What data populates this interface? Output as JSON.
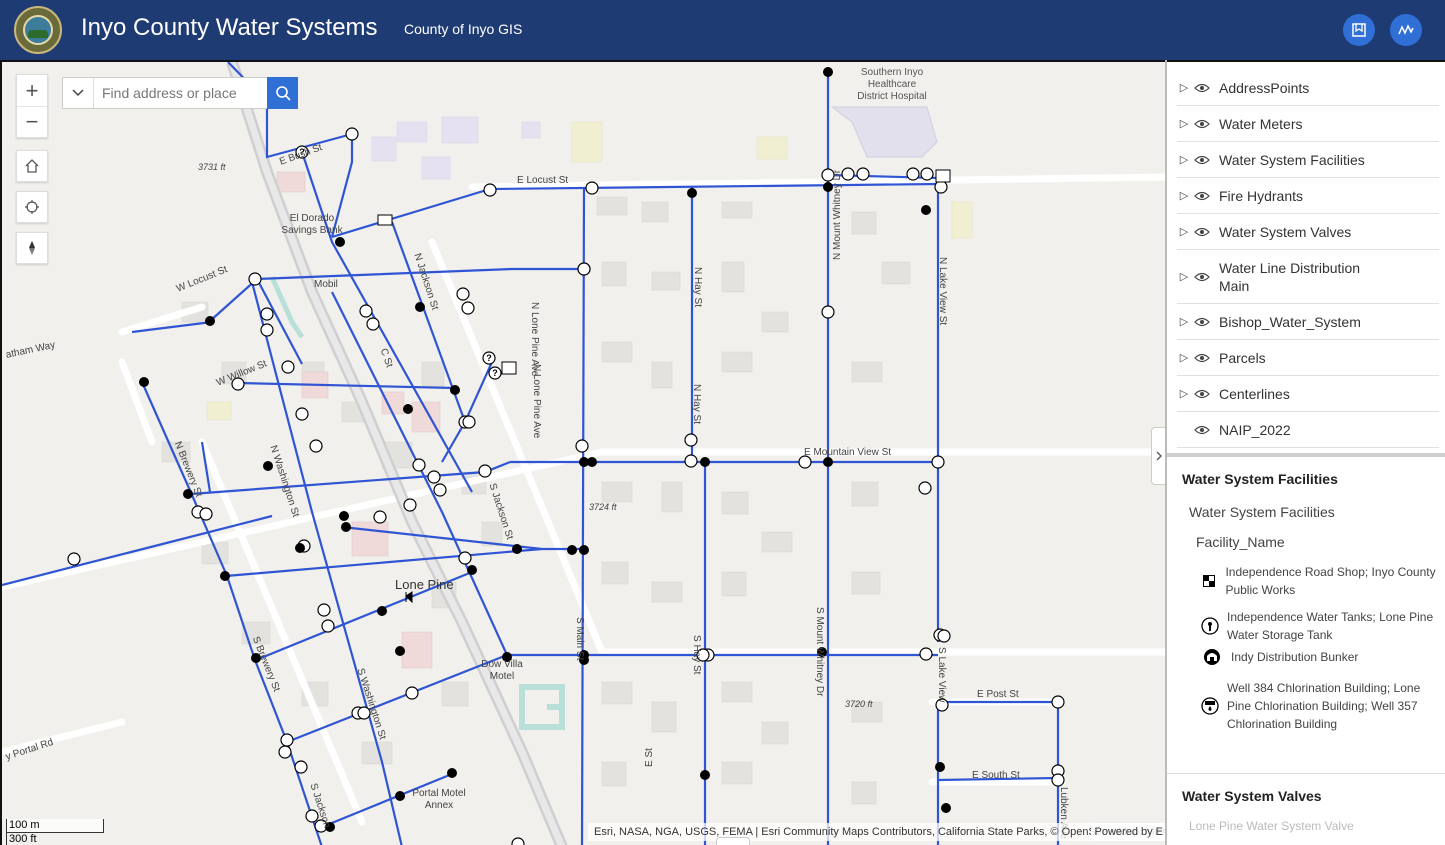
{
  "header": {
    "title": "Inyo County Water Systems",
    "subtitle": "County of Inyo GIS",
    "bg_color": "#1f3b73",
    "buttons": [
      {
        "icon": "bookmark-icon"
      },
      {
        "icon": "chart-icon"
      }
    ]
  },
  "map": {
    "search_placeholder": "Find address or place",
    "labels": {
      "hospital_1": "Southern Inyo",
      "hospital_2": "Healthcare",
      "hospital_3": "District Hospital",
      "elev_1": "3731 ft",
      "elev_2": "3724 ft",
      "elev_3": "3720 ft",
      "bank_1": "El Dorado",
      "bank_2": "Savings Bank",
      "mobil": "Mobil",
      "town": "Lone Pine",
      "motel_1": "Dow Villa",
      "motel_2": "Motel",
      "annex_1": "Portal Motel",
      "annex_2": "Annex"
    },
    "streets": {
      "e_locust": "E Locust St",
      "w_locust": "W Locust St",
      "w_willow": "W Willow St",
      "e_bush": "E Bush St",
      "e_mountain_view": "E Mountain View St",
      "e_post": "E Post St",
      "e_south": "E South St",
      "n_lone_pine": "N Lone Pine Ave",
      "n_hay": "N Hay St",
      "n_mount_whitney": "N Mount Whitney Dr",
      "s_mount_whitney": "S Mount Whitney Dr",
      "n_lake_view": "N Lake View St",
      "s_lake_view": "S Lake View",
      "n_jackson_upper": "N Jackson St",
      "n_jackson": "S Jackson St",
      "n_washington": "N Washington St",
      "s_washington": "S Washington St",
      "n_brewery": "N Brewery St",
      "s_brewery": "S Brewery St",
      "s_hay": "S Hay St",
      "s_lone_pine": "S Lone Pine Ave",
      "c_st": "C St",
      "n_lone_pine_2": "N Lone Pine Ave",
      "n_hay_2": "N Hay St",
      "n_lake_view_2": "N Lake View St",
      "lubken": "Lubken Ave",
      "e_st": "E St",
      "n_lakeview_lower": "N Lake View",
      "s_main": "S Main St",
      "jackson_2": "N Jackson St",
      "portal_rd": "y Portal Rd",
      "statham": "atham Way",
      "s_lake_south": "S Lake View",
      "s_lone_pine_lower": "S Lone Pine",
      "lone_pine_lower2": "S Lone Pine",
      "jawood": "S Jackson"
    },
    "scale_top": "100 m",
    "scale_bottom": "300 ft",
    "attribution": "Esri, NASA, NGA, USGS, FEMA | Esri Community Maps Contributors, California State Parks, © OpenStreetMap, Microsoft, Esri, TomTom, Garmin...",
    "powered_by": "Powered by E",
    "line_color": "#2f55d4"
  },
  "layers": [
    {
      "name": "AddressPoints",
      "expandable": true
    },
    {
      "name": "Water Meters",
      "expandable": true
    },
    {
      "name": "Water System Facilities",
      "expandable": true
    },
    {
      "name": "Fire Hydrants",
      "expandable": true
    },
    {
      "name": "Water System Valves",
      "expandable": true
    },
    {
      "name": "Water Line Distribution Main",
      "expandable": true
    },
    {
      "name": "Bishop_Water_System",
      "expandable": true
    },
    {
      "name": "Parcels",
      "expandable": true
    },
    {
      "name": "Centerlines",
      "expandable": true
    },
    {
      "name": "NAIP_2022",
      "expandable": false
    }
  ],
  "legend": {
    "heading": "Water System Facilities",
    "subheading": "Water System Facilities",
    "field": "Facility_Name",
    "items": [
      {
        "label": "Independence Road Shop; Inyo County Public Works",
        "icon": "checker-icon"
      },
      {
        "label": "Independence Water Tanks; Lone Pine Water Storage Tank",
        "icon": "tank-icon"
      },
      {
        "label": "Indy Distribution Bunker",
        "icon": "bunker-icon"
      },
      {
        "label": "Well 384 Chlorination Building; Lone Pine Chlorination Building; Well 357 Chlorination Building",
        "icon": "chlorination-icon"
      }
    ],
    "heading2": "Water System Valves",
    "faded_text": "Lone Pine Water System Valve"
  }
}
